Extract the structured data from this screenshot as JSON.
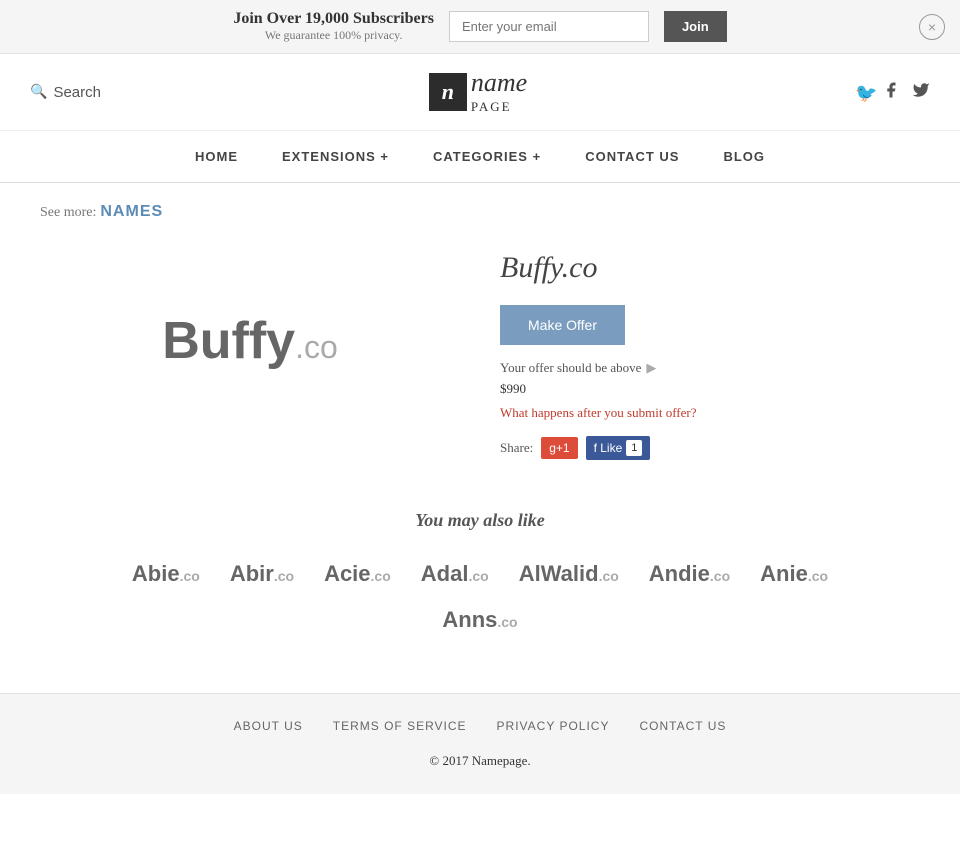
{
  "banner": {
    "headline": "Join Over 19,000 Subscribers",
    "subtext": "We guarantee 100% privacy.",
    "email_placeholder": "Enter your email",
    "join_label": "Join",
    "close_label": "×"
  },
  "header": {
    "search_label": "Search",
    "logo_letter": "n",
    "logo_name": "name",
    "logo_sub": "PAGE",
    "facebook_icon": "f",
    "twitter_icon": "t"
  },
  "nav": {
    "items": [
      {
        "label": "HOME",
        "href": "#"
      },
      {
        "label": "EXTENSIONS +",
        "href": "#"
      },
      {
        "label": "CATEGORIES +",
        "href": "#"
      },
      {
        "label": "CONTACT US",
        "href": "#"
      },
      {
        "label": "BLOG",
        "href": "#"
      }
    ]
  },
  "breadcrumb": {
    "see_more": "See more:",
    "link_label": "NAMES"
  },
  "product": {
    "logo_text": "Buffy",
    "logo_ext": ".co",
    "title": "Buffy.co",
    "make_offer_label": "Make Offer",
    "offer_note": "Your offer should be above",
    "offer_price": "$990",
    "what_happens": "What happens after you submit offer?",
    "share_label": "Share:",
    "g_plus_label": "g+1",
    "fb_like_label": "f Like",
    "fb_count": "1"
  },
  "also_like": {
    "heading": "You may also like",
    "domains": [
      {
        "name": "Abie",
        "ext": ".co"
      },
      {
        "name": "Abir",
        "ext": ".co"
      },
      {
        "name": "Acie",
        "ext": ".co"
      },
      {
        "name": "Adal",
        "ext": ".co"
      },
      {
        "name": "AlWalid",
        "ext": ".co"
      },
      {
        "name": "Andie",
        "ext": ".co"
      },
      {
        "name": "Anie",
        "ext": ".co"
      }
    ],
    "domain_row2": [
      {
        "name": "Anns",
        "ext": ".co"
      }
    ]
  },
  "footer": {
    "links": [
      {
        "label": "ABOUT US"
      },
      {
        "label": "TERMS OF SERVICE"
      },
      {
        "label": "PRIVACY POLICY"
      },
      {
        "label": "CONTACT US"
      }
    ],
    "copy": "© 2017 ",
    "brand": "Namepage."
  }
}
